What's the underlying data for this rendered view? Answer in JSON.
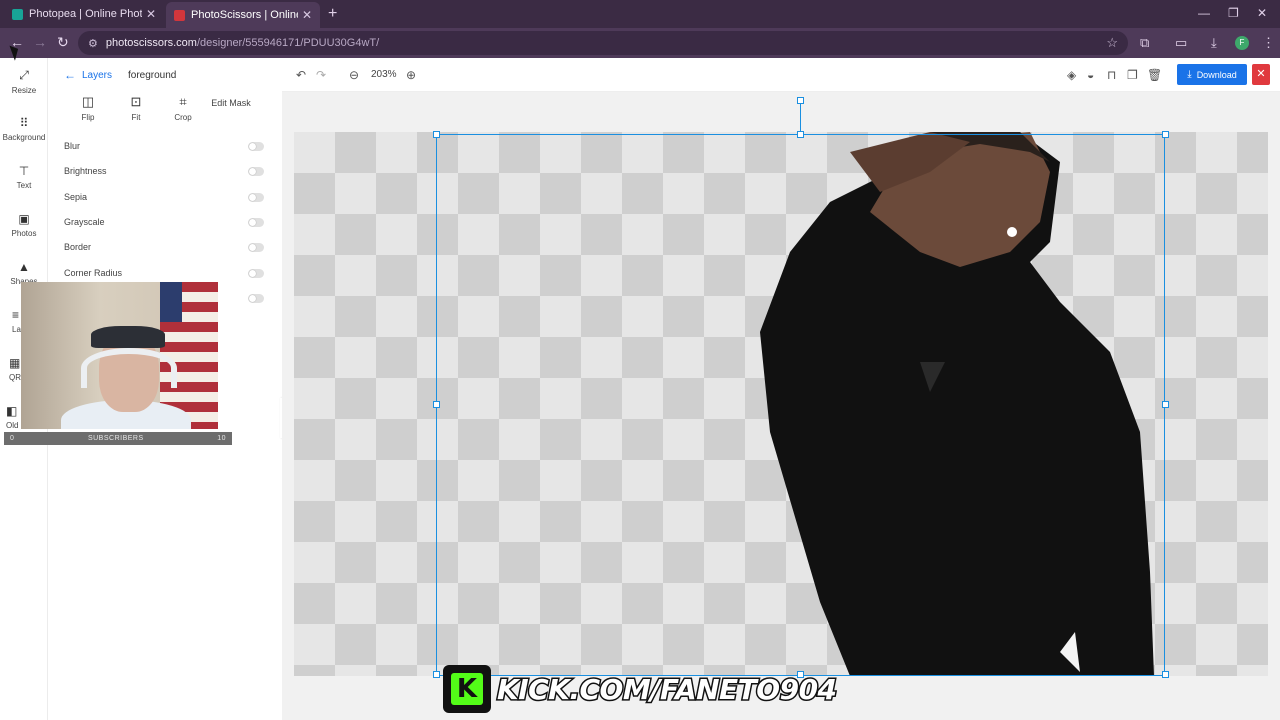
{
  "browser": {
    "tabs": [
      {
        "label": "Photopea | Online Photo Editor",
        "favicon_color": "#18a497",
        "active": false
      },
      {
        "label": "PhotoScissors | Online Backgro",
        "favicon_color": "#d2363c",
        "active": true
      }
    ],
    "url_host": "photoscissors.com",
    "url_path": "/designer/555946171/PDUU30G4wT/",
    "profile_initial": "F"
  },
  "rail": {
    "items": [
      {
        "label": "Resize",
        "icon": "resize-icon"
      },
      {
        "label": "Background",
        "icon": "grid-icon"
      },
      {
        "label": "Text",
        "icon": "text-icon"
      },
      {
        "label": "Photos",
        "icon": "image-icon"
      },
      {
        "label": "Shapes",
        "icon": "shapes-icon"
      },
      {
        "label": "La",
        "icon": "layers-icon"
      },
      {
        "label": "QR",
        "icon": "qr-icon"
      },
      {
        "label": "Old",
        "icon": "old-icon"
      }
    ]
  },
  "panel": {
    "back_label": "Layers",
    "layer_name": "foreground",
    "tools": [
      {
        "label": "Flip",
        "icon": "flip-icon"
      },
      {
        "label": "Fit",
        "icon": "fit-icon"
      },
      {
        "label": "Crop",
        "icon": "crop-icon"
      },
      {
        "label": "Edit Mask",
        "icon": "mask-icon"
      }
    ],
    "filters": [
      {
        "label": "Blur",
        "enabled": false
      },
      {
        "label": "Brightness",
        "enabled": false
      },
      {
        "label": "Sepia",
        "enabled": false
      },
      {
        "label": "Grayscale",
        "enabled": false
      },
      {
        "label": "Border",
        "enabled": false
      },
      {
        "label": "Corner Radius",
        "enabled": false
      }
    ]
  },
  "overlay": {
    "subscribers_label": "SUBSCRIBERS",
    "subscribers_min": "0",
    "subscribers_max": "10",
    "kick_text": "KICK.COM/FANETO904"
  },
  "editor": {
    "zoom": "203%",
    "download_label": "Download",
    "accent_color": "#1a73e8",
    "close_color": "#e0393e"
  }
}
